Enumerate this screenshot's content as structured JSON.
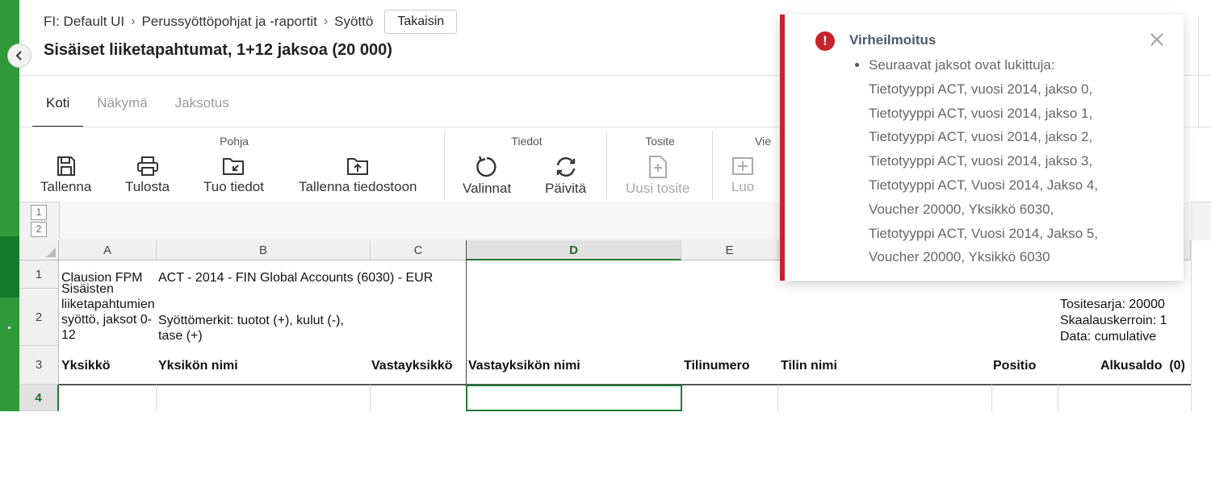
{
  "breadcrumb": {
    "items": [
      "FI: Default UI",
      "Perussyöttöpohjat ja -raportit",
      "Syöttö"
    ],
    "back_label": "Takaisin"
  },
  "page_title": "Sisäiset liiketapahtumat, 1+12 jaksoa (20 000)",
  "tabs": [
    {
      "label": "Koti",
      "active": true
    },
    {
      "label": "Näkymä",
      "active": false
    },
    {
      "label": "Jaksotus",
      "active": false
    }
  ],
  "ribbon": {
    "pohja": {
      "title": "Pohja",
      "tallenna": "Tallenna",
      "tulosta": "Tulosta",
      "tuo": "Tuo tiedot",
      "tallenna_tiedostoon": "Tallenna tiedostoon"
    },
    "tiedot": {
      "title": "Tiedot",
      "valinnat": "Valinnat",
      "paivita": "Päivitä"
    },
    "tosite": {
      "title": "Tosite",
      "uusi": "Uusi tosite"
    },
    "vie": {
      "title": "Vie",
      "luo": "Luo"
    }
  },
  "sheet": {
    "outline_levels": [
      "1",
      "2"
    ],
    "columns": [
      "A",
      "B",
      "C",
      "D",
      "E"
    ],
    "selected_column": "D",
    "rows": [
      "1",
      "2",
      "3",
      "4"
    ],
    "selected_row": "4",
    "r1": {
      "a": "Clausion FPM",
      "b": "ACT - 2014 - FIN Global Accounts (6030) - EUR"
    },
    "r2": {
      "a": "Sisäisten liiketapahtumien syöttö, jaksot 0-12",
      "b": "Syöttömerkit: tuotot (+), kulut (-), tase (+)",
      "right1": "Tositesarja: 20000",
      "right2": "Skaalauskerroin: 1",
      "right3": "Data: cumulative"
    },
    "headers": [
      "Yksikkö",
      "Yksikön nimi",
      "Vastayksikkö",
      "Vastayksikön nimi",
      "Tilinumero",
      "Tilin nimi",
      "Positio",
      "Alkusaldo  (0)"
    ]
  },
  "notification": {
    "title": "Virheilmoitus",
    "lines": [
      "Seuraavat jaksot ovat lukittuja:",
      "Tietotyyppi ACT, vuosi 2014, jakso 0,",
      "Tietotyyppi ACT, vuosi 2014, jakso 1,",
      "Tietotyyppi ACT, vuosi 2014, jakso 2,",
      "Tietotyyppi ACT, vuosi 2014, jakso 3,",
      "Tietotyyppi ACT, Vuosi 2014, Jakso 4,",
      "Voucher 20000, Yksikkö 6030,",
      "Tietotyyppi ACT, Vuosi 2014, Jakso 5,",
      "Voucher 20000, Yksikkö 6030"
    ]
  },
  "colors": {
    "accent_green": "#2f9a3a",
    "error_red": "#c8222a",
    "select_green": "#1f7a34"
  }
}
